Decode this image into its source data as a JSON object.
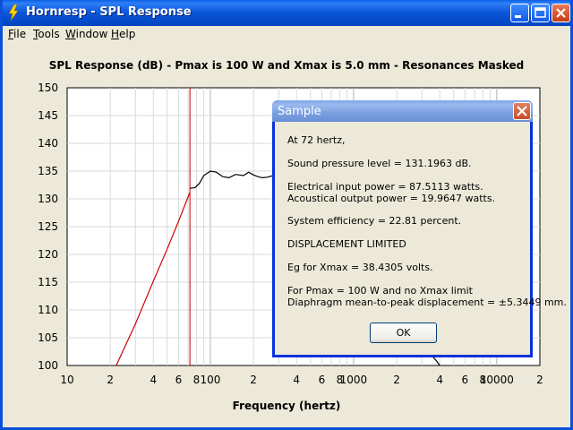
{
  "window": {
    "title": "Hornresp - SPL Response"
  },
  "menu": [
    {
      "label": "File",
      "key": "F"
    },
    {
      "label": "Tools",
      "key": "T"
    },
    {
      "label": "Window",
      "key": "W"
    },
    {
      "label": "Help",
      "key": "H"
    }
  ],
  "chart_data": {
    "type": "line",
    "title": "SPL Response (dB) - Pmax is 100 W and Xmax is 5.0 mm - Resonances Masked",
    "xlabel": "Frequency (hertz)",
    "ylabel": "",
    "x_scale": "log",
    "xlim": [
      10,
      20000
    ],
    "ylim": [
      100,
      150
    ],
    "y_ticks": [
      "150",
      "145",
      "140",
      "135",
      "130",
      "125",
      "120",
      "115",
      "110",
      "105",
      "100"
    ],
    "x_tick_labels": [
      {
        "f": 10,
        "t": "10"
      },
      {
        "f": 20,
        "t": "2"
      },
      {
        "f": 40,
        "t": "4"
      },
      {
        "f": 60,
        "t": "6"
      },
      {
        "f": 80,
        "t": "8"
      },
      {
        "f": 100,
        "t": "100"
      },
      {
        "f": 200,
        "t": "2"
      },
      {
        "f": 400,
        "t": "4"
      },
      {
        "f": 600,
        "t": "6"
      },
      {
        "f": 800,
        "t": "8"
      },
      {
        "f": 1000,
        "t": "1000"
      },
      {
        "f": 2000,
        "t": "2"
      },
      {
        "f": 4000,
        "t": "4"
      },
      {
        "f": 6000,
        "t": "6"
      },
      {
        "f": 8000,
        "t": "8"
      },
      {
        "f": 10000,
        "t": "10000"
      },
      {
        "f": 20000,
        "t": "2"
      }
    ],
    "marker_frequency": 72,
    "series": [
      {
        "color": "#cc0000",
        "x": [
          22,
          30,
          40,
          50,
          60,
          72
        ],
        "y": [
          100,
          107.5,
          115.2,
          121,
          126,
          131.2
        ]
      },
      {
        "color": "#000000",
        "x": [
          72,
          78,
          84,
          90,
          100,
          110,
          122,
          135,
          150,
          170,
          185,
          200,
          215,
          230,
          250,
          275
        ],
        "y": [
          131.9,
          132,
          132.8,
          134.2,
          135,
          134.8,
          134,
          133.8,
          134.4,
          134.2,
          134.8,
          134.3,
          134,
          133.8,
          133.9,
          134.2
        ]
      },
      {
        "color": "#000000",
        "x": [
          3600,
          3800,
          4000
        ],
        "y": [
          101.5,
          100.8,
          100
        ]
      }
    ]
  },
  "dialog": {
    "title": "Sample",
    "lines": [
      "At 72 hertz,",
      "Sound pressure level = 131.1963 dB.",
      "Electrical input power = 87.5113 watts.",
      "Acoustical output power = 19.9647 watts.",
      "System efficiency = 22.81 percent.",
      "DISPLACEMENT LIMITED",
      "Eg for Xmax = 38.4305 volts.",
      "For Pmax = 100 W and no Xmax limit",
      "Diaphragm mean-to-peak displacement = ±5.3449 mm."
    ],
    "ok_label": "OK"
  }
}
